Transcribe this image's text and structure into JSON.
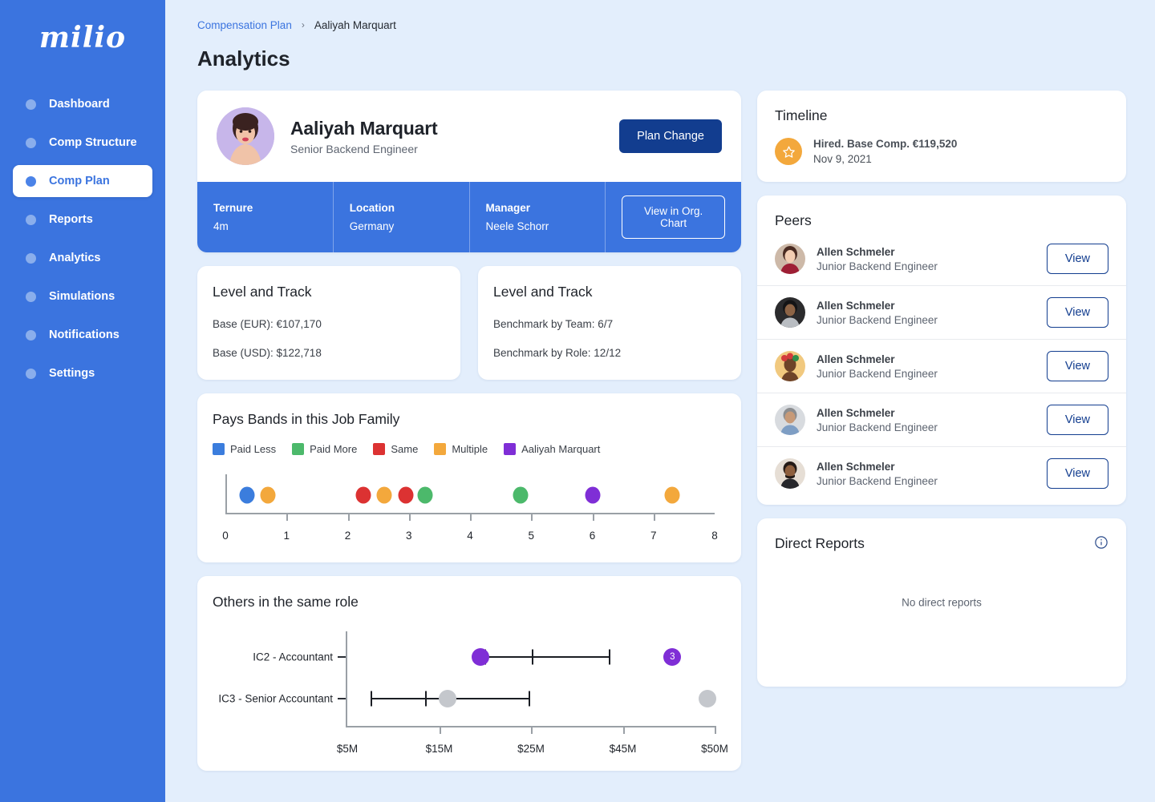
{
  "brand": {
    "logo_text": "milio",
    "sidebar_color": "#3b74df",
    "accent": "#123d8f"
  },
  "sidebar": {
    "items": [
      {
        "label": "Dashboard",
        "active": false
      },
      {
        "label": "Comp Structure",
        "active": false
      },
      {
        "label": "Comp Plan",
        "active": true
      },
      {
        "label": "Reports",
        "active": false
      },
      {
        "label": "Analytics",
        "active": false
      },
      {
        "label": "Simulations",
        "active": false
      },
      {
        "label": "Notifications",
        "active": false
      },
      {
        "label": "Settings",
        "active": false
      }
    ]
  },
  "breadcrumb": {
    "parent": "Compensation Plan",
    "separator": "›",
    "current": "Aaliyah Marquart"
  },
  "page": {
    "title": "Analytics"
  },
  "profile": {
    "name": "Aaliyah Marquart",
    "role": "Senior Backend Engineer",
    "plan_change_label": "Plan Change",
    "org_chart_label": "View in Org. Chart",
    "stats": [
      {
        "label": "Ternure",
        "value": "4m"
      },
      {
        "label": "Location",
        "value": "Germany"
      },
      {
        "label": "Manager",
        "value": "Neele Schorr"
      }
    ]
  },
  "level_track_left": {
    "title": "Level and Track",
    "lines": [
      "Base (EUR): €107,170",
      "Base (USD): $122,718"
    ]
  },
  "level_track_right": {
    "title": "Level and Track",
    "lines": [
      "Benchmark by Team: 6/7",
      "Benchmark by Role: 12/12"
    ]
  },
  "timeline": {
    "title": "Timeline",
    "events": [
      {
        "icon": "star-icon",
        "title": "Hired. Base Comp. €119,520",
        "date": "Nov 9, 2021"
      }
    ]
  },
  "peers": {
    "title": "Peers",
    "view_label": "View",
    "rows": [
      {
        "name": "Allen Schmeler",
        "role": "Junior Backend Engineer",
        "avatar": "#8d5b4d"
      },
      {
        "name": "Allen Schmeler",
        "role": "Junior Backend Engineer",
        "avatar": "#2e2e30"
      },
      {
        "name": "Allen Schmeler",
        "role": "Junior Backend Engineer",
        "avatar": "#f0c878"
      },
      {
        "name": "Allen Schmeler",
        "role": "Junior Backend Engineer",
        "avatar": "#c9cdd2"
      },
      {
        "name": "Allen Schmeler",
        "role": "Junior Backend Engineer",
        "avatar": "#d8cfc6"
      }
    ]
  },
  "direct_reports": {
    "title": "Direct Reports",
    "empty_text": "No direct reports",
    "info_icon": "info-icon"
  },
  "chart_data": [
    {
      "type": "scatter",
      "title": "Pays Bands in this Job Family",
      "xlabel": "",
      "ylabel": "",
      "xlim": [
        0,
        8
      ],
      "grid": false,
      "legend_position": "top-left",
      "tick_labels": [
        "0",
        "1",
        "2",
        "3",
        "4",
        "5",
        "6",
        "7",
        "8"
      ],
      "legend": [
        {
          "name": "Paid Less",
          "color": "#3b7ddd"
        },
        {
          "name": "Paid More",
          "color": "#4cb96b"
        },
        {
          "name": "Same",
          "color": "#dc3232"
        },
        {
          "name": "Multiple",
          "color": "#f3a83c"
        },
        {
          "name": "Aaliyah Marquart",
          "color": "#7f2ed6"
        }
      ],
      "points": [
        {
          "x": 0.35,
          "color": "#3b7ddd",
          "series": "Paid Less"
        },
        {
          "x": 0.7,
          "color": "#f3a83c",
          "series": "Multiple"
        },
        {
          "x": 2.25,
          "color": "#dc3232",
          "series": "Same"
        },
        {
          "x": 2.6,
          "color": "#f3a83c",
          "series": "Multiple"
        },
        {
          "x": 2.95,
          "color": "#dc3232",
          "series": "Same"
        },
        {
          "x": 3.27,
          "color": "#4cb96b",
          "series": "Paid More"
        },
        {
          "x": 4.83,
          "color": "#4cb96b",
          "series": "Paid More"
        },
        {
          "x": 6.0,
          "color": "#7f2ed6",
          "series": "Aaliyah Marquart"
        },
        {
          "x": 7.3,
          "color": "#f3a83c",
          "series": "Multiple"
        }
      ]
    },
    {
      "type": "scatter",
      "title": "Others in the same role",
      "xlabel": "",
      "ylabel": "",
      "grid": false,
      "tick_labels": [
        "$5M",
        "$15M",
        "$25M",
        "$45M",
        "$50M"
      ],
      "tick_positions": [
        0,
        0.25,
        0.5,
        0.75,
        1.0
      ],
      "rows": [
        {
          "label": "IC2 - Accountant",
          "range_start": 0.375,
          "range_end": 0.715,
          "median": 0.505,
          "marker": 0.363,
          "marker_color": "#7f2ed6",
          "marker_label": "",
          "outlier": 0.885,
          "outlier_color": "#7f2ed6",
          "outlier_label": "3"
        },
        {
          "label": "IC3 - Senior Accountant",
          "range_start": 0.065,
          "range_end": 0.495,
          "median": 0.215,
          "marker": 0.272,
          "marker_color": "#c4c7cc",
          "marker_label": "",
          "outlier": 0.98,
          "outlier_color": "#c4c7cc",
          "outlier_label": ""
        }
      ]
    }
  ]
}
